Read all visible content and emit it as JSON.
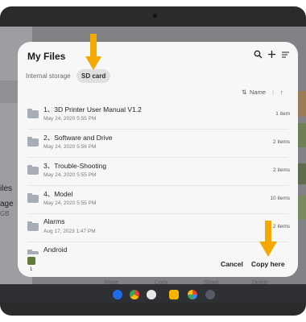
{
  "dialog": {
    "title": "My Files",
    "header_icons": [
      "search-icon",
      "plus-icon",
      "select-icon"
    ],
    "tabs": [
      {
        "label": "Internal storage",
        "active": false
      },
      {
        "label": "SD card",
        "active": true
      }
    ],
    "sort": {
      "label": "Name",
      "sort_icon": "sort-icon",
      "direction_icon": "arrow-up-icon"
    },
    "items": [
      {
        "name": "1、3D Printer User Manual V1.2",
        "date": "May 24, 2020 5:55 PM",
        "count": "1 item"
      },
      {
        "name": "2、Software and Drive",
        "date": "May 24, 2020 5:56 PM",
        "count": "2 items"
      },
      {
        "name": "3、Trouble-Shooting",
        "date": "May 24, 2020 5:55 PM",
        "count": "2 items"
      },
      {
        "name": "4、Model",
        "date": "May 24, 2020 5:55 PM",
        "count": "10 items"
      },
      {
        "name": "Alarms",
        "date": "Aug 17, 2023 1:47 PM",
        "count": "2 items"
      },
      {
        "name": "Android",
        "date": "",
        "count": ""
      }
    ],
    "footer": {
      "selected_count": "1",
      "cancel_label": "Cancel",
      "confirm_label": "Copy here"
    }
  },
  "background": {
    "left_labels": [
      "iles",
      "age",
      "GB"
    ],
    "bottom_labels": [
      "Move",
      "Copy",
      "Share",
      "Delete"
    ]
  },
  "colors": {
    "arrow": "#f5a800",
    "dialog_bg": "#f7f7f7",
    "folder": "#a7adb6"
  }
}
